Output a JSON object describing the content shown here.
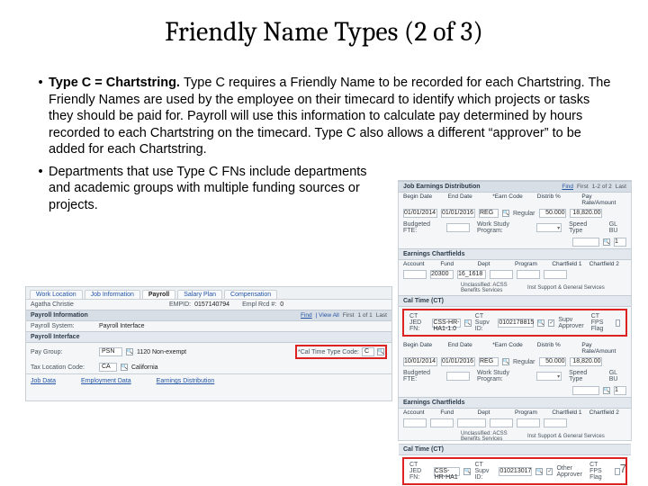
{
  "title": "Friendly Name Types (2 of 3)",
  "bullets": {
    "b1_bold": "Type C = Chartstring.  ",
    "b1_rest": "Type C requires a Friendly Name to be recorded for each Chartstring.  The Friendly Names are used by the employee on their timecard to identify which projects or tasks they should be paid for. Payroll will use this information to calculate pay determined by hours recorded to each Chartstring on the timecard. Type C also allows a different “approver” to be added for each Chartstring.",
    "b2": "Departments that use Type C FNs include departments and academic groups with multiple funding sources or projects."
  },
  "pagenum": "7",
  "left": {
    "tabs": [
      "Work Location",
      "Job Information",
      "Payroll",
      "Salary Plan",
      "Compensation"
    ],
    "active_tab": "Payroll",
    "empid_lbl": "EMPID:",
    "empid": "0157140794",
    "emplrcd_lbl": "Empl Rcd #:",
    "emplrcd": "0",
    "section": "Payroll Information",
    "toolbar_find": "Find",
    "toolbar_viewall": "| View All",
    "toolbar_first": "First",
    "toolbar_count": "1 of 1",
    "toolbar_last": "Last",
    "paysys_lbl": "Payroll System:",
    "paysys": "Payroll Interface",
    "pi_hdr": "Payroll Interface",
    "paygroup_lbl": "Pay Group:",
    "paygroup": "PSN",
    "paygroup_desc": "1120 Non-exempt",
    "taxloc_lbl": "Tax Location Code:",
    "taxloc": "CA",
    "taxloc_desc": "California",
    "caltime_lbl": "*Cal Time Type Code:",
    "caltime": "C",
    "links": [
      "Job Data",
      "Employment Data",
      "Earnings Distribution"
    ]
  },
  "right": {
    "title": "Job Earnings Distribution",
    "find": "Find",
    "first": "First",
    "count": "1-2 of 2",
    "last": "Last",
    "col_begin": "Begin Date",
    "col_end": "End Date",
    "col_earn": "*Earn Code",
    "col_distpct": "Distrib %",
    "col_payrate": "Pay Rate/Amount",
    "begin1": "01/01/2014",
    "end1": "01/01/2016",
    "earn1": "REG",
    "distpct1": "50.000",
    "payrate1": "18,820.00",
    "budfte_lbl": "Budgeted FTE:",
    "wsp_lbl": "Work Study Program:",
    "speed_lbl": "Speed Type",
    "glbu_lbl": "GL BU",
    "glbu": "1",
    "chart_hdr": "Earnings Chartfields",
    "c_acct": "Account",
    "c_fund": "Fund",
    "c_dept": "Dept",
    "c_prog": "Program",
    "c_cf1": "Chartfield 1",
    "c_cf2": "Chartfield 2",
    "fund1": "20300",
    "dept1": "16_1618",
    "dept1b": "Unclassified: ACSS Benefits Services",
    "prog1b": "Inst Support & General Services",
    "ct_hdr": "Cal Time (CT)",
    "ctjed_lbl": "CT JED FN:",
    "ctjed1": "CSS-HR-HA1-1.0",
    "ctsupv_lbl": "CT Supv ID:",
    "ctsupv1": "0102178815",
    "supvapp_lbl": "Supv Approver",
    "ctfps_lbl": "CT FPS Flag",
    "begin2": "10/01/2014",
    "end2": "01/01/2016",
    "earn2": "REG",
    "distpct2": "50.000",
    "payrate2": "18,820.00",
    "ctjed2": "CSS-HR-HA1",
    "ctsupv2": "010213017",
    "othapp_lbl": "Other Approver"
  }
}
